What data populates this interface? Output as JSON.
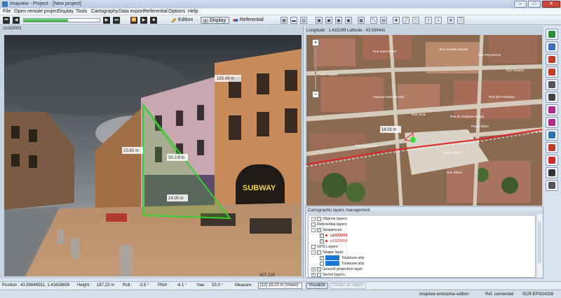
{
  "window": {
    "title": "imajview - Project - [New project]",
    "controls": [
      "–",
      "□",
      "✕"
    ]
  },
  "menu": [
    "File",
    "Open remote project",
    "Display",
    "Tools",
    "Cartography",
    "Data export",
    "Referential",
    "Options",
    "Help"
  ],
  "toolbar": {
    "progress_percent": 58,
    "modes": {
      "edition": "Edition",
      "display": "Display",
      "referential": "Referential"
    }
  },
  "photo_panel": {
    "header": "s1023003",
    "pixel_readout": "907,135",
    "sign_text": "SUBWAY",
    "measurements": {
      "top": "183.49 m",
      "left": "15.60 m",
      "middle": "55.2.8 m",
      "bottom": "14.00 m"
    }
  },
  "map_panel": {
    "header": "Longitude : 1.433269 Latitude : 43.599441",
    "measure_label": "14.00 m",
    "streets": [
      "Rue Saint-Rome",
      "Rue Antoine Bouvier",
      "Rue Peyrolières",
      "Rue Filatiers",
      "Rue Tripière",
      "Rue des Paradoux",
      "Impasse Saint-Nicolas",
      "Rue Jouls",
      "Rue du Chapeau Rouge",
      "Rue Reclusane",
      "Place Olivier",
      "Place Olivier",
      "Rue Olivier"
    ],
    "zoom": {
      "in": "+",
      "out": "−"
    }
  },
  "side_tools": [
    {
      "icon": "chart-icon",
      "color": "#2a8f3a"
    },
    {
      "icon": "layers-icon",
      "color": "#3e6fb8"
    },
    {
      "icon": "route-icon",
      "color": "#c23b2a"
    },
    {
      "icon": "video-icon",
      "color": "#c23b2a"
    },
    {
      "icon": "snapshot-icon",
      "color": "#555555"
    },
    {
      "icon": "camera-icon",
      "color": "#444444"
    },
    {
      "icon": "zoom-in-icon",
      "color": "#b22a8f"
    },
    {
      "icon": "zoom-out-icon",
      "color": "#b22a8f"
    },
    {
      "icon": "globe-icon",
      "color": "#2f6fb3"
    },
    {
      "icon": "pin-icon",
      "color": "#c23b2a"
    },
    {
      "icon": "help-icon",
      "color": "#d22a2a"
    },
    {
      "icon": "ruler-icon",
      "color": "#333333"
    },
    {
      "icon": "pen-icon",
      "color": "#555555"
    }
  ],
  "layers": {
    "title": "Cartographic layers management",
    "items": [
      {
        "label": "Objects layers",
        "checked": false,
        "expander": "-"
      },
      {
        "label": "Referential layers",
        "checked": false,
        "expander": ""
      },
      {
        "label": "Sequences",
        "checked": true,
        "expander": "-"
      },
      {
        "label": "s1023003",
        "checked": true,
        "expander": ""
      },
      {
        "label": "s1023004",
        "checked": true,
        "expander": ""
      },
      {
        "label": "GPS Layers",
        "checked": false,
        "expander": ""
      },
      {
        "label": "Shape layer",
        "checked": false,
        "expander": "-"
      },
      {
        "label": "Toulouse.shp",
        "checked": true,
        "expander": ""
      },
      {
        "label": "Toulouse.shp",
        "checked": false,
        "expander": ""
      },
      {
        "label": "Ground projection layer",
        "checked": true,
        "expander": "+"
      },
      {
        "label": "Vector layers",
        "checked": false,
        "expander": "+"
      }
    ]
  },
  "status": {
    "position_label": "Position :",
    "position_value": "43.59846551, 1.43428659",
    "height_label": "Height :",
    "height_value": "187.22 m",
    "roll_label": "Roll :",
    "roll_value": "-2.5 °",
    "pitch_label": "Pitch :",
    "pitch_value": "-6.1 °",
    "yaw_label": "Yaw :",
    "yaw_value": "53.0 °",
    "measure_label": "Measure :",
    "measure_value": "[12] 18.23 m (Video)",
    "visualize_button": "Visualize",
    "create_object_button": "Create an object"
  },
  "footer": {
    "edition": "imajview enterprise edition",
    "ref_status": "Ref. connected",
    "crs": "SCR:EPSG4326"
  }
}
